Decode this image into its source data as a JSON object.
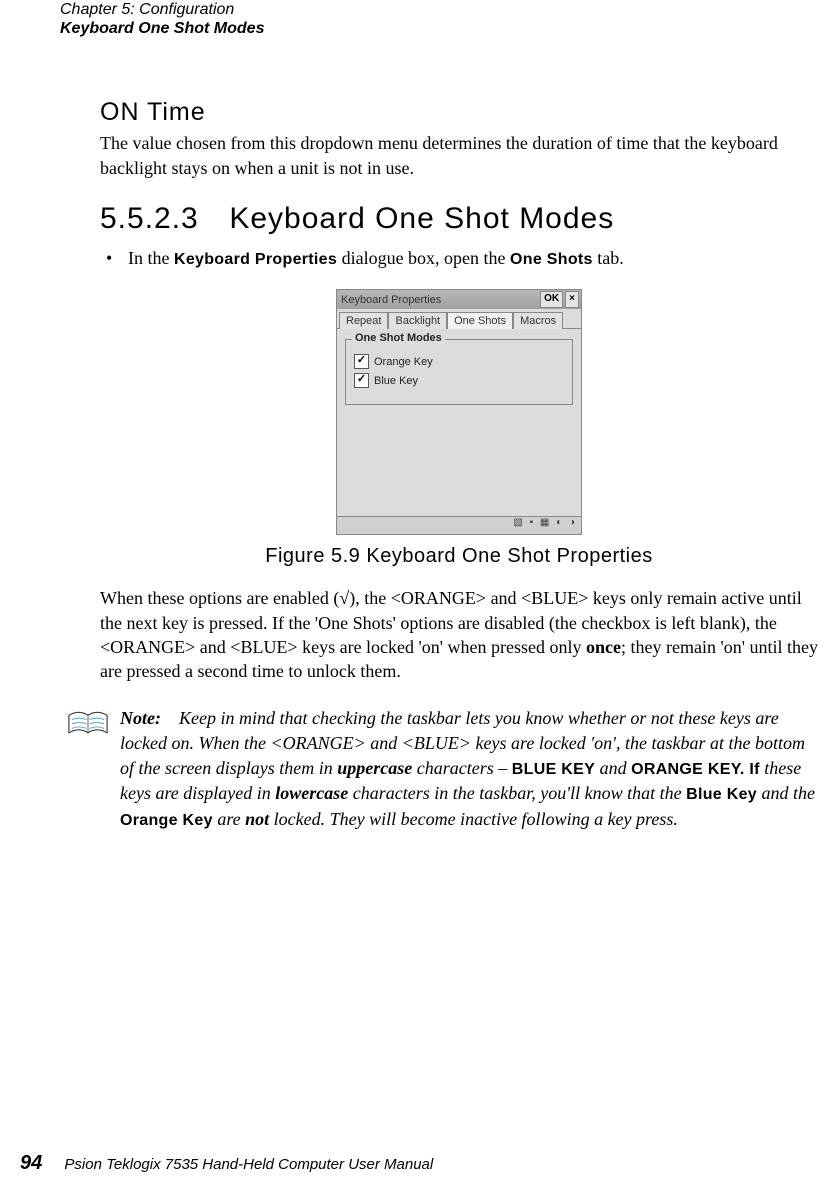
{
  "header": {
    "chapter_line": "Chapter 5: Configuration",
    "section_line": "Keyboard One Shot Modes"
  },
  "section": {
    "ontime_heading": "ON Time",
    "ontime_body": "The value chosen from this dropdown menu determines the duration of time that the keyboard backlight stays on when a unit is not in use.",
    "heading_number": "5.5.2.3",
    "heading_text": "Keyboard One Shot Modes",
    "bullet_pre": "In the ",
    "bullet_kbdprops": "Keyboard Properties",
    "bullet_mid": " dialogue box, open the ",
    "bullet_oneshots": "One Shots",
    "bullet_post": " tab."
  },
  "dialog": {
    "title": "Keyboard Properties",
    "ok": "OK",
    "close": "×",
    "tabs": [
      "Repeat",
      "Backlight",
      "One Shots",
      "Macros"
    ],
    "legend": "One Shot Modes",
    "chk_orange": "Orange Key",
    "chk_blue": "Blue Key",
    "tray": "▧ ▪ ▦ ◐ ◑"
  },
  "figure_caption": "Figure 5.9 Keyboard One Shot Properties",
  "paragraph": {
    "p_pre": "When these options are enabled (√), the <ORANGE> and <BLUE> keys only remain active until the next key is pressed. If the 'One Shots' options are disabled (the checkbox is left blank), the <ORANGE> and <BLUE> keys are locked 'on' when pressed only ",
    "once": "once",
    "p_post": "; they remain 'on' until they are pressed a second time to unlock them."
  },
  "note": {
    "label": "Note:",
    "b_pre": "Keep in mind that checking the taskbar lets you know whether or not these keys are locked on. When the <ORANGE> and <BLUE> keys are locked 'on', the taskbar at the bottom of the screen displays them in ",
    "uppercase": "uppercase",
    "b_mid1": " characters – ",
    "BLUEKEY": "BLUE KEY",
    "and1": " and ",
    "ORANGEKEY": "ORANGE KEY. If",
    "b_mid2": " these keys are displayed in ",
    "lowercase": "lowercase",
    "b_mid3": " characters in the taskbar, you'll know that the ",
    "BlueKey": "Blue Key",
    "b_mid4": " and the ",
    "OrangeKey": "Orange Key",
    "b_mid5": " are ",
    "not": "not",
    "b_post": " locked. They will become inactive following a key press."
  },
  "footer": {
    "page_number": "94",
    "publication": "Psion Teklogix 7535 Hand-Held Computer User Manual"
  }
}
